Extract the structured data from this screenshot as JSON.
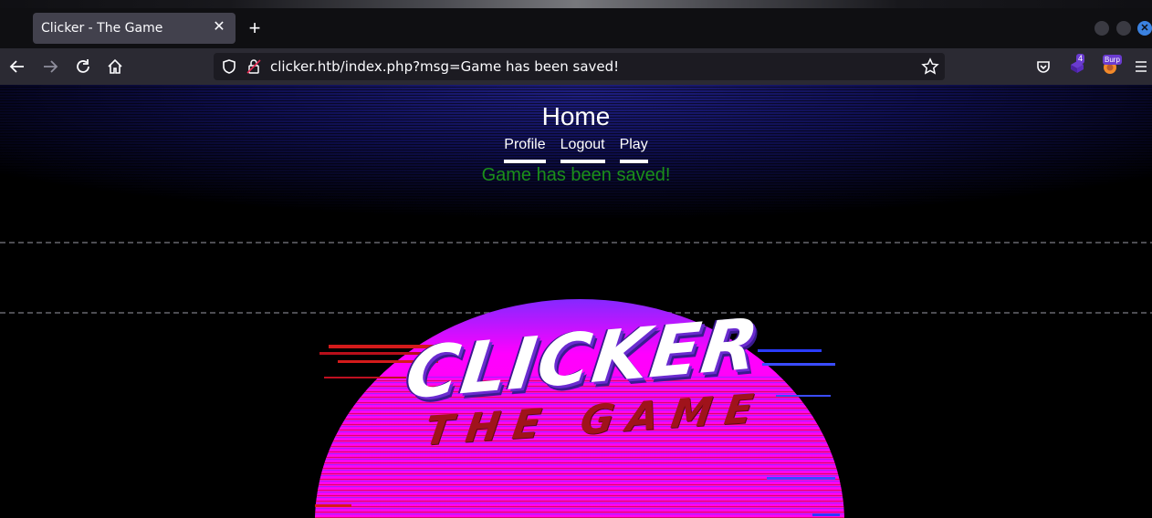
{
  "browser": {
    "tab_title": "Clicker - The Game",
    "url": "clicker.htb/index.php?msg=Game has been saved!",
    "extension_badge": "4",
    "burp_badge": "Burp"
  },
  "page": {
    "title": "Home",
    "nav": [
      {
        "label": "Profile"
      },
      {
        "label": "Logout"
      },
      {
        "label": "Play"
      }
    ],
    "message": "Game has been saved!",
    "message_color": "#1b8f1b",
    "logo": {
      "line1": "CLICKER",
      "line2": "THE GAME"
    }
  },
  "colors": {
    "tab_active": "#42414d",
    "toolbar": "#2b2a33",
    "urlbar": "#1c1b22",
    "sun_top": "#ff00ff",
    "sun_stripe": "#e0003a"
  }
}
